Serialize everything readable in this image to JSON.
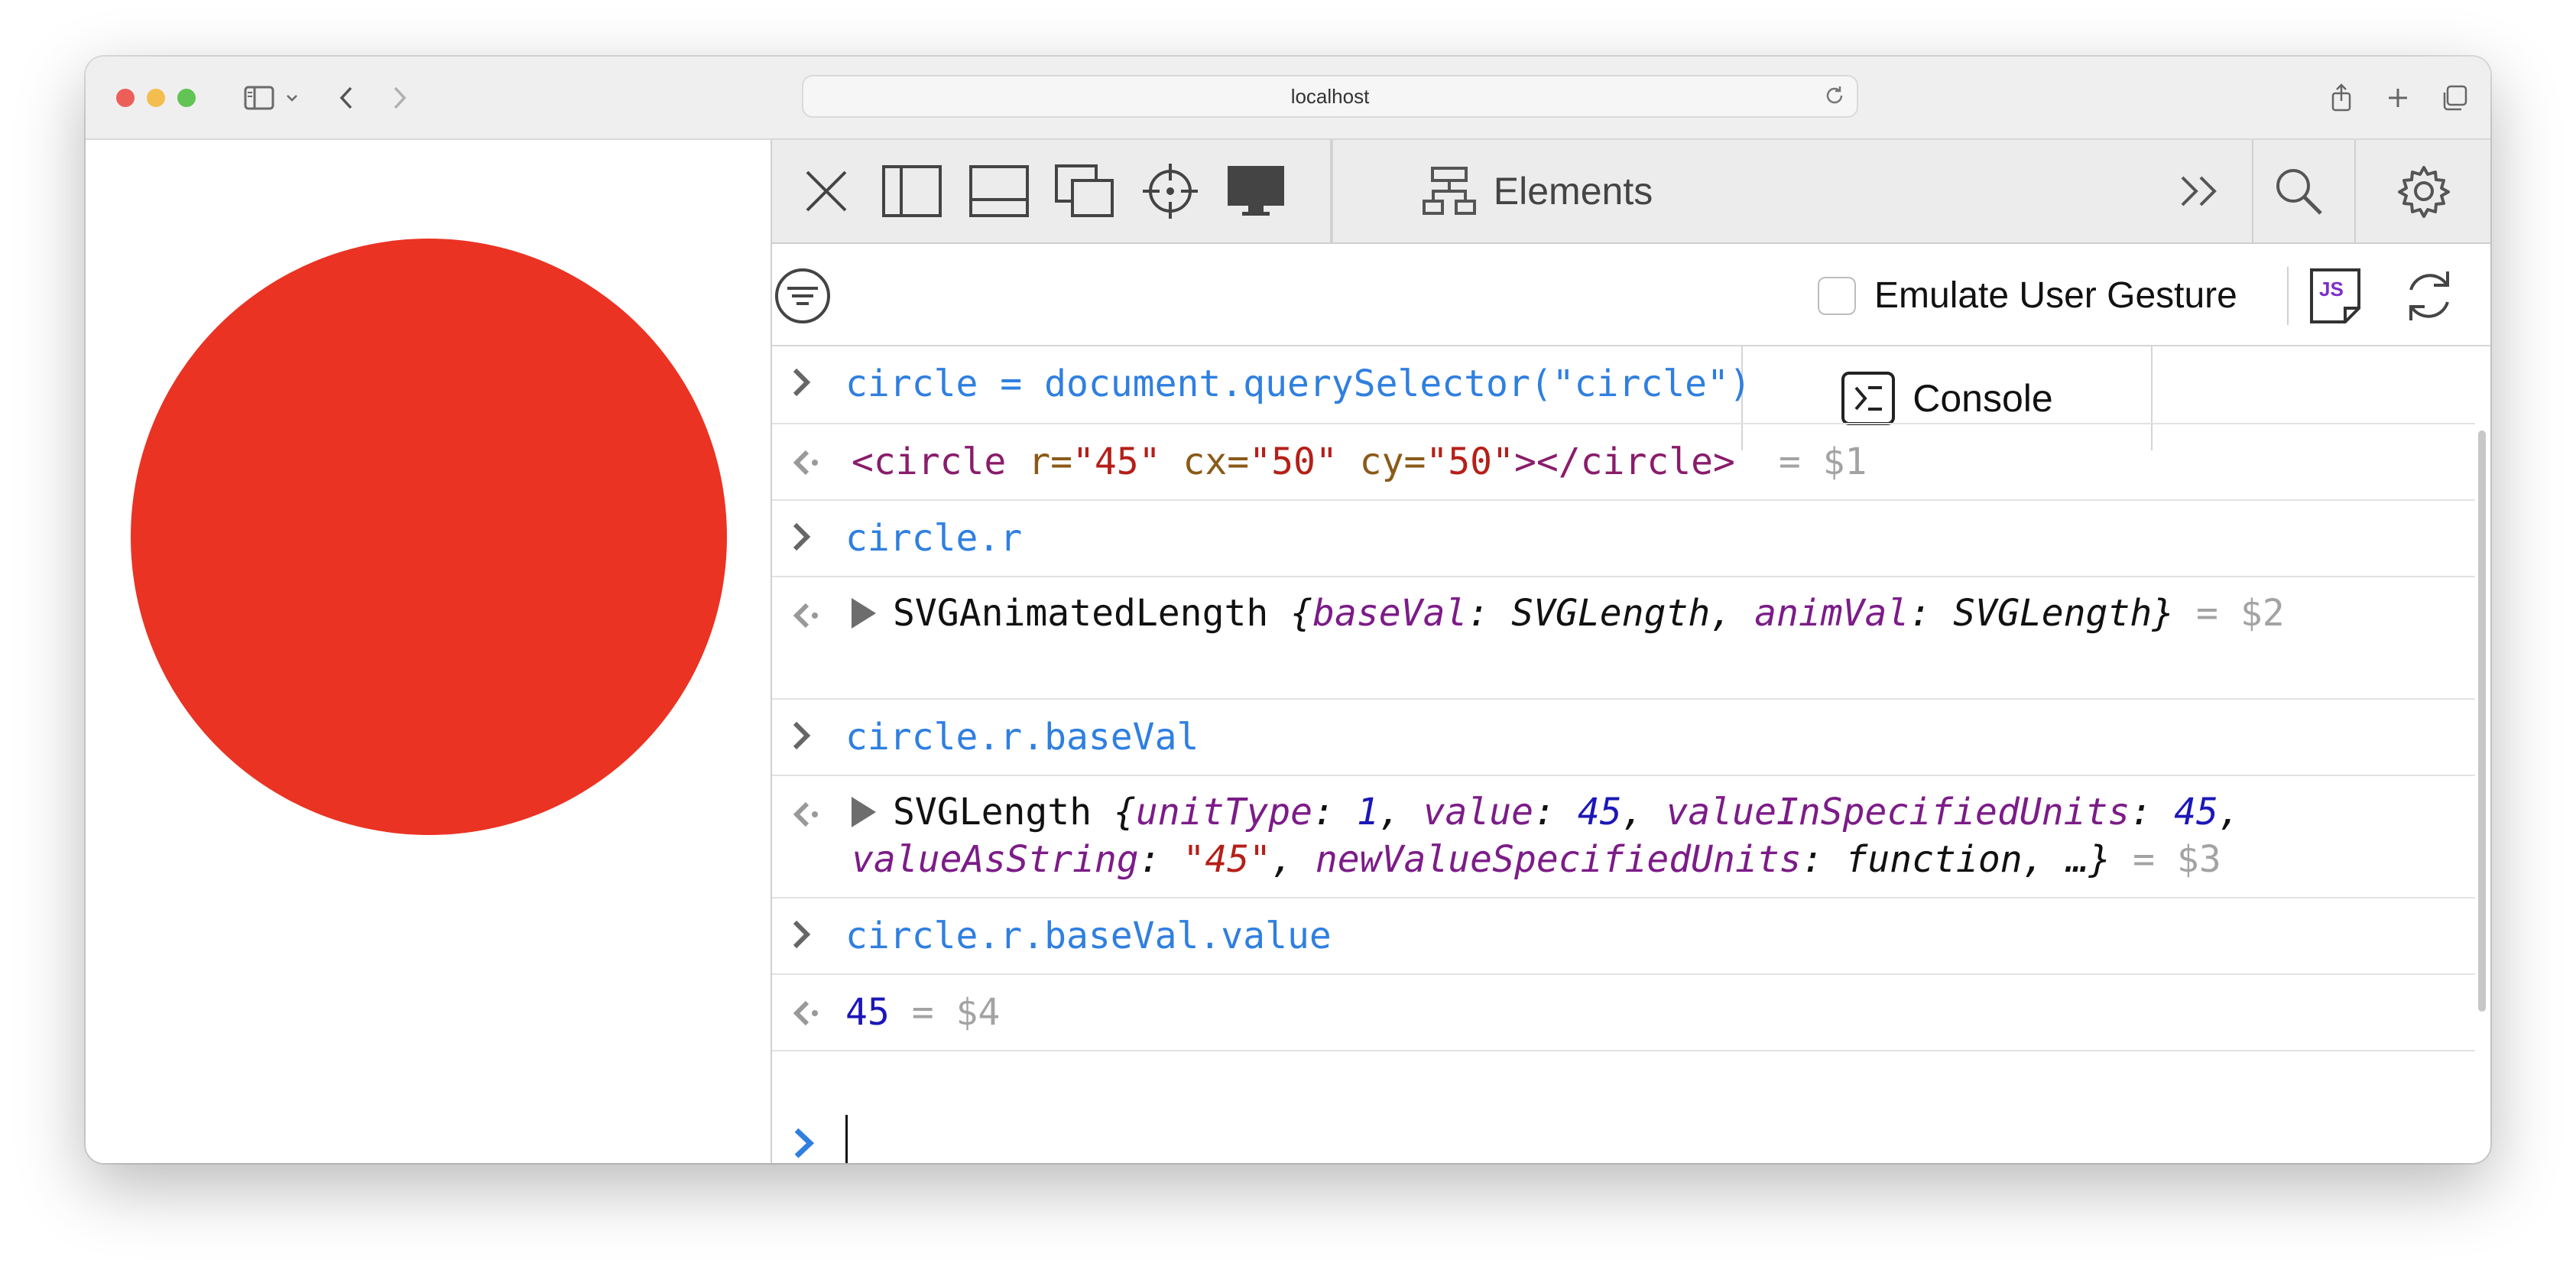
{
  "browser": {
    "url": "localhost"
  },
  "page": {
    "circle_color": "#ea3323"
  },
  "devtools": {
    "tabs": [
      {
        "label": "Elements"
      },
      {
        "label": "Console"
      }
    ],
    "toolbar_icons": [
      "close-icon",
      "dock-side-icon",
      "dock-bottom-icon",
      "undock-icon",
      "element-picker-icon",
      "device-icon"
    ],
    "right_icons": [
      "more-tabs-icon",
      "search-icon",
      "settings-icon"
    ],
    "filter": {
      "emulate_label": "Emulate User Gesture",
      "emulate_checked": false,
      "js_badge": "JS"
    },
    "console": {
      "entries": [
        {
          "type": "input",
          "text": "circle = document.querySelector(\"circle\")"
        },
        {
          "type": "output",
          "tag_open": "<circle ",
          "attr1": "r=",
          "val1": "\"45\"",
          "attr2": " cx=",
          "val2": "\"50\"",
          "attr3": " cy=",
          "val3": "\"50\"",
          "tag_close": "></circle>",
          "result": " = $1"
        },
        {
          "type": "input",
          "text": "circle.r"
        },
        {
          "type": "output",
          "name": "SVGAnimatedLength ",
          "brace_open": "{",
          "p1": "baseVal",
          "c1": ": ",
          "v1": "SVGLength",
          "sep": ", ",
          "p2": "animVal",
          "c2": ": ",
          "v2": "SVGLength",
          "brace_close": "}",
          "result": " = $2"
        },
        {
          "type": "input",
          "text": "circle.r.baseVal"
        },
        {
          "type": "output",
          "name": "SVGLength ",
          "brace_open": "{",
          "p1": "unitType",
          "c1": ": ",
          "v1": "1",
          "s1": ", ",
          "p2": "value",
          "c2": ": ",
          "v2": "45",
          "s2": ", ",
          "p3": "valueInSpecifiedUnits",
          "c3": ": ",
          "v3": "45",
          "s3": ", ",
          "p4": "valueAsString",
          "c4": ": ",
          "v4": "\"45\"",
          "s4": ", ",
          "p5": "newValueSpecifiedUnits",
          "c5": ": ",
          "v5": "function",
          "s5": ", …",
          "brace_close": "}",
          "result": " = $3"
        },
        {
          "type": "input",
          "text": "circle.r.baseVal.value"
        },
        {
          "type": "output",
          "value": "45",
          "result": " = $4"
        }
      ]
    }
  }
}
